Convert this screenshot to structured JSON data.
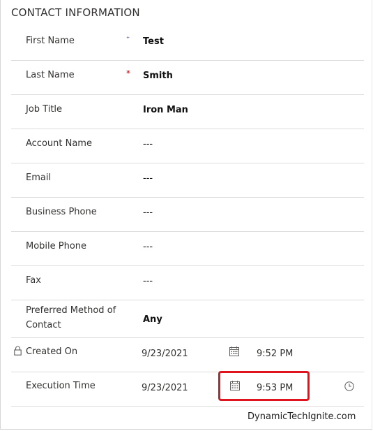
{
  "section": {
    "title": "CONTACT INFORMATION"
  },
  "fields": [
    {
      "label": "First Name",
      "value": "Test",
      "required_mark": "⁺"
    },
    {
      "label": "Last Name",
      "value": "Smith",
      "required_mark": "*"
    },
    {
      "label": "Job Title",
      "value": "Iron Man"
    },
    {
      "label": "Account Name",
      "value": "---"
    },
    {
      "label": "Email",
      "value": "---"
    },
    {
      "label": "Business Phone",
      "value": "---"
    },
    {
      "label": "Mobile Phone",
      "value": "---"
    },
    {
      "label": "Fax",
      "value": "---"
    },
    {
      "label": "Preferred Method of Contact",
      "value": "Any"
    }
  ],
  "created_on": {
    "label": "Created On",
    "date": "9/23/2021",
    "time": "9:52 PM",
    "locked": true
  },
  "execution_time": {
    "label": "Execution Time",
    "date": "9/23/2021",
    "time": "9:53 PM"
  },
  "watermark": "DynamicTechIgnite.com",
  "colors": {
    "required_blue": "#1f3b8c",
    "required_red": "#c00000",
    "highlight": "#e0141e"
  },
  "icons": {
    "lock": "lock-icon",
    "calendar": "calendar-icon",
    "clock": "clock-icon"
  }
}
